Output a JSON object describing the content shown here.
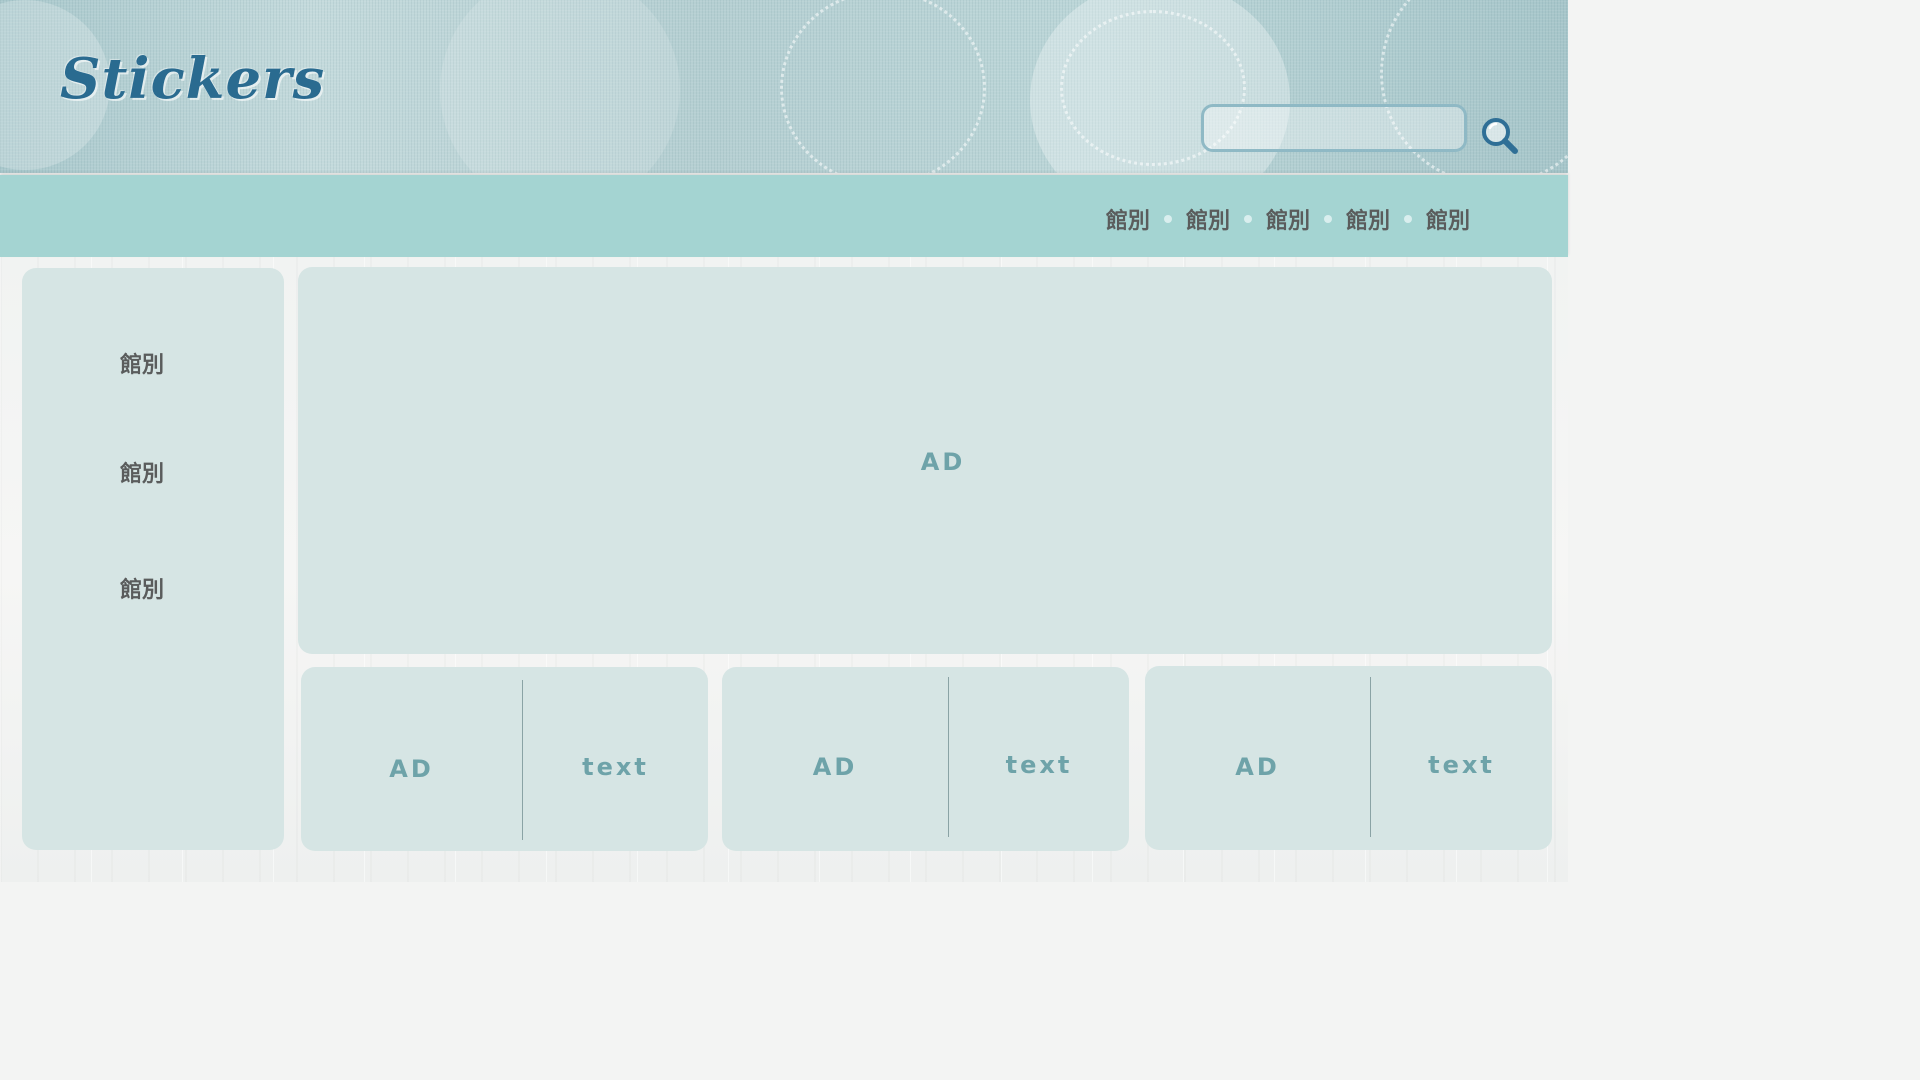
{
  "header": {
    "logo_text": "Stickers",
    "search": {
      "placeholder": "",
      "value": ""
    },
    "icons": {
      "search": "search-icon"
    }
  },
  "nav": {
    "items": [
      {
        "label": "館別"
      },
      {
        "label": "館別"
      },
      {
        "label": "館別"
      },
      {
        "label": "館別"
      },
      {
        "label": "館別"
      }
    ]
  },
  "sidebar": {
    "items": [
      {
        "label": "館別"
      },
      {
        "label": "館別"
      },
      {
        "label": "館別"
      }
    ]
  },
  "main": {
    "banner_ad": {
      "label": "AD"
    },
    "cards": [
      {
        "ad_label": "AD",
        "text_label": "text"
      },
      {
        "ad_label": "AD",
        "text_label": "text"
      },
      {
        "ad_label": "AD",
        "text_label": "text"
      }
    ]
  },
  "colors": {
    "navbar": "#a4d4d2",
    "panel": "#d6e5e4",
    "logo": "#2a6b90",
    "panel_text": "#6ea3a9",
    "menu_text": "#5a5c5c"
  }
}
